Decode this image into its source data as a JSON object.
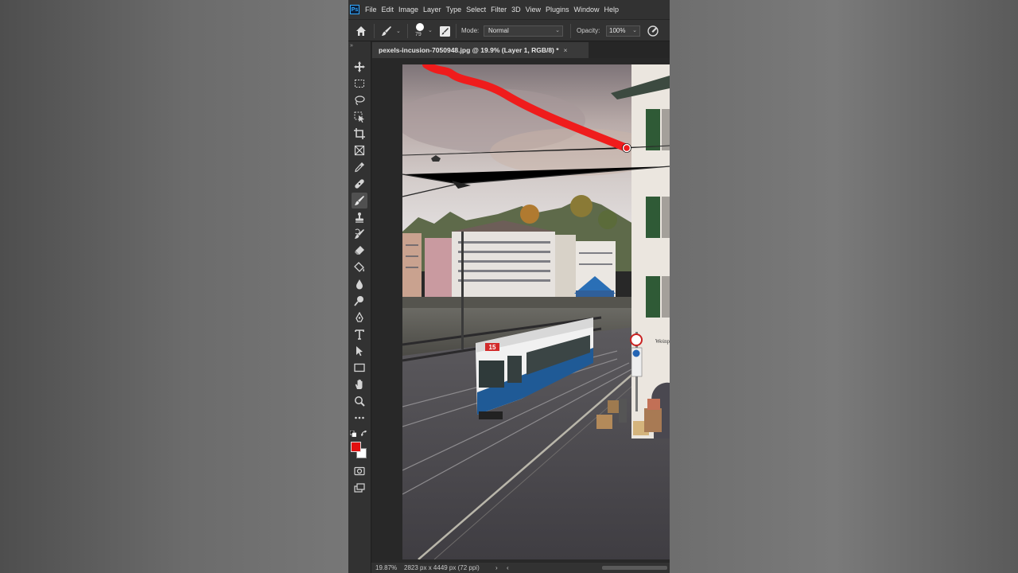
{
  "app": {
    "logo_text": "Ps"
  },
  "menubar": {
    "items": [
      "File",
      "Edit",
      "Image",
      "Layer",
      "Type",
      "Select",
      "Filter",
      "3D",
      "View",
      "Plugins",
      "Window",
      "Help"
    ]
  },
  "options": {
    "brush_size": "79",
    "mode_label": "Mode:",
    "mode_value": "Normal",
    "opacity_label": "Opacity:",
    "opacity_value": "100%"
  },
  "document": {
    "tab_title": "pexels-incusion-7050948.jpg @ 19.9% (Layer 1, RGB/8) *",
    "close_glyph": "×"
  },
  "photo": {
    "tram_number": "15",
    "sign_text": "Weinp"
  },
  "status": {
    "zoom": "19.87%",
    "info": "2823 px x 4449 px (72 ppi)",
    "arrow_right": "›",
    "arrow_left": "‹"
  },
  "colors": {
    "foreground": "#e01010",
    "background": "#ffffff",
    "paint_stroke": "#ef1c1c"
  },
  "tools": [
    "move-icon",
    "marquee-icon",
    "lasso-icon",
    "object-select-icon",
    "crop-icon",
    "frame-icon",
    "eyedropper-icon",
    "healing-brush-icon",
    "brush-icon",
    "clone-stamp-icon",
    "history-brush-icon",
    "eraser-icon",
    "paint-bucket-icon",
    "blur-icon",
    "dodge-icon",
    "pen-icon",
    "type-icon",
    "path-select-icon",
    "rectangle-icon",
    "hand-icon",
    "zoom-icon",
    "more-tools-icon",
    "quick-mask-icon",
    "screen-mode-icon"
  ]
}
